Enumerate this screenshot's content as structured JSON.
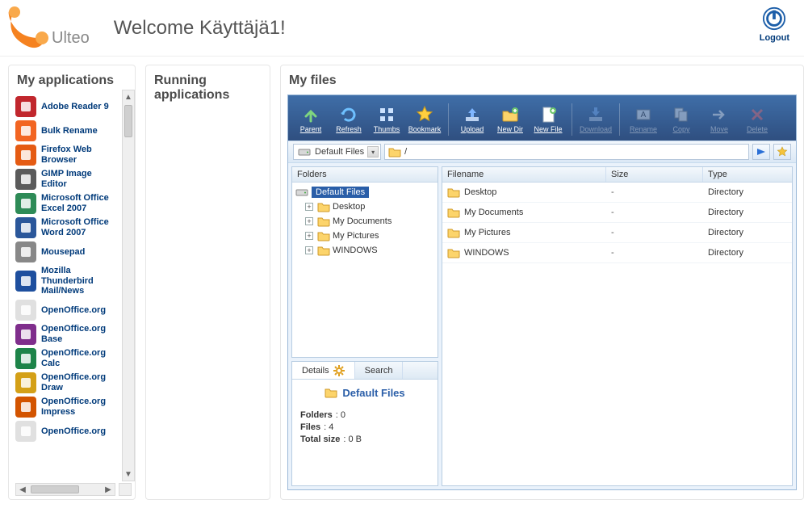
{
  "header": {
    "brand": "Ulteo",
    "welcome": "Welcome Käyttäjä1!",
    "logout": "Logout"
  },
  "apps": {
    "title": "My applications",
    "items": [
      {
        "label": "Adobe Reader 9",
        "icon": "adobe",
        "bg": "#c1272d"
      },
      {
        "label": "Bulk Rename",
        "icon": "bulk",
        "bg": "#f26522"
      },
      {
        "label": "Firefox Web Browser",
        "icon": "firefox",
        "bg": "#e55b13"
      },
      {
        "label": "GIMP Image Editor",
        "icon": "gimp",
        "bg": "#5b5b5b"
      },
      {
        "label": "Microsoft Office Excel 2007",
        "icon": "excel",
        "bg": "#2e8b57"
      },
      {
        "label": "Microsoft Office Word 2007",
        "icon": "word",
        "bg": "#2b579a"
      },
      {
        "label": "Mousepad",
        "icon": "mousepad",
        "bg": "#888"
      },
      {
        "label": "Mozilla Thunderbird Mail/News",
        "icon": "thunderbird",
        "bg": "#1e4f9e"
      },
      {
        "label": "OpenOffice.org",
        "icon": "ooo",
        "bg": "#e0e0e0"
      },
      {
        "label": "OpenOffice.org Base",
        "icon": "ooo-base",
        "bg": "#7f2e8c"
      },
      {
        "label": "OpenOffice.org Calc",
        "icon": "ooo-calc",
        "bg": "#1e8449"
      },
      {
        "label": "OpenOffice.org Draw",
        "icon": "ooo-draw",
        "bg": "#d4a017"
      },
      {
        "label": "OpenOffice.org Impress",
        "icon": "ooo-impress",
        "bg": "#d35400"
      },
      {
        "label": "OpenOffice.org",
        "icon": "ooo2",
        "bg": "#e0e0e0"
      }
    ]
  },
  "running": {
    "title": "Running applications"
  },
  "files": {
    "title": "My files",
    "toolbar": [
      {
        "id": "parent",
        "label": "Parent",
        "enabled": true,
        "shape": "arrow-up"
      },
      {
        "id": "refresh",
        "label": "Refresh",
        "enabled": true,
        "shape": "refresh"
      },
      {
        "id": "thumbs",
        "label": "Thumbs",
        "enabled": true,
        "shape": "grid"
      },
      {
        "id": "bookmark",
        "label": "Bookmark",
        "enabled": true,
        "shape": "star"
      },
      {
        "id": "sep1",
        "sep": true
      },
      {
        "id": "upload",
        "label": "Upload",
        "enabled": true,
        "shape": "upload"
      },
      {
        "id": "newdir",
        "label": "New Dir",
        "enabled": true,
        "shape": "newfolder"
      },
      {
        "id": "newfile",
        "label": "New File",
        "enabled": true,
        "shape": "newfile"
      },
      {
        "id": "sep2",
        "sep": true
      },
      {
        "id": "download",
        "label": "Download",
        "enabled": false,
        "shape": "download"
      },
      {
        "id": "sep3",
        "sep": true
      },
      {
        "id": "rename",
        "label": "Rename",
        "enabled": false,
        "shape": "rename"
      },
      {
        "id": "copy",
        "label": "Copy",
        "enabled": false,
        "shape": "copy"
      },
      {
        "id": "move",
        "label": "Move",
        "enabled": false,
        "shape": "move"
      },
      {
        "id": "delete",
        "label": "Delete",
        "enabled": false,
        "shape": "delete"
      }
    ],
    "pathbar": {
      "volume": "Default Files",
      "path": "/"
    },
    "tree": {
      "header": "Folders",
      "root": "Default Files",
      "children": [
        {
          "label": "Desktop"
        },
        {
          "label": "My Documents"
        },
        {
          "label": "My Pictures"
        },
        {
          "label": "WINDOWS"
        }
      ]
    },
    "list": {
      "headers": {
        "name": "Filename",
        "size": "Size",
        "type": "Type"
      },
      "rows": [
        {
          "name": "Desktop",
          "size": "-",
          "type": "Directory"
        },
        {
          "name": "My Documents",
          "size": "-",
          "type": "Directory"
        },
        {
          "name": "My Pictures",
          "size": "-",
          "type": "Directory"
        },
        {
          "name": "WINDOWS",
          "size": "-",
          "type": "Directory"
        }
      ]
    },
    "details": {
      "tabs": {
        "details": "Details",
        "search": "Search"
      },
      "title": "Default Files",
      "folders_label": "Folders",
      "folders": "0",
      "files_label": "Files",
      "files_count": "4",
      "size_label": "Total size",
      "size": "0 B"
    }
  }
}
